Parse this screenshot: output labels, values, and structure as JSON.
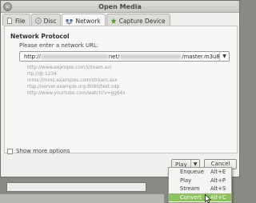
{
  "window": {
    "title": "Open Media",
    "close_glyph": "×"
  },
  "tabs": [
    {
      "label": "File",
      "icon": "file-icon"
    },
    {
      "label": "Disc",
      "icon": "disc-icon"
    },
    {
      "label": "Network",
      "icon": "network-icon"
    },
    {
      "label": "Capture Device",
      "icon": "capture-device-icon"
    }
  ],
  "network": {
    "protocol_heading": "Network Protocol",
    "url_prompt": "Please enter a network URL:",
    "url_prefix": "http://",
    "url_mid": "net/",
    "url_suffix": "/master.m3u8",
    "examples": [
      "http://www.example.com/stream.avi",
      "rtp://@:1234",
      "mms://mms.examples.com/stream.asx",
      "rtsp://server.example.org:8080/test.sdp",
      "http://www.yourtube.com/watch?v=gg64x"
    ]
  },
  "show_more_options": "Show more options",
  "buttons": {
    "play": "Play",
    "cancel": "Cancel"
  },
  "play_menu": [
    {
      "label": "Enqueue",
      "shortcut": "Alt+E"
    },
    {
      "label": "Play",
      "shortcut": "Alt+P"
    },
    {
      "label": "Stream",
      "shortcut": "Alt+S"
    },
    {
      "label": "Convert",
      "shortcut": "Alt+C"
    }
  ],
  "colors": {
    "menu_highlight": "#8ec25c",
    "window_bg": "#efefed"
  }
}
